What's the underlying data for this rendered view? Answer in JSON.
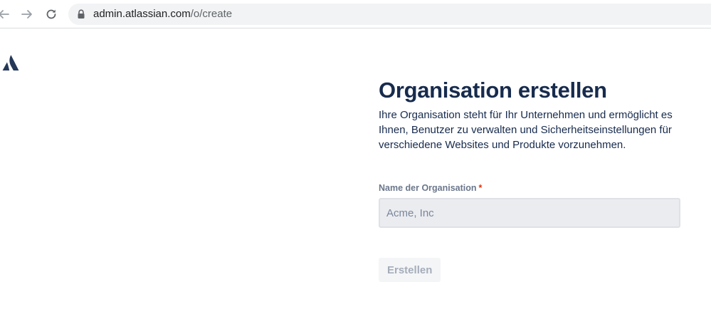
{
  "browser": {
    "url_host": "admin.atlassian.com",
    "url_path": "/o/create",
    "icons": [
      "back-arrow-icon",
      "forward-arrow-icon",
      "reload-icon",
      "lock-icon"
    ]
  },
  "logo": {
    "icon": "atlassian-logo-icon",
    "color": "#253858"
  },
  "form": {
    "title": "Organisation erstellen",
    "description": "Ihre Organisation steht für Ihr Unternehmen und ermöglicht es Ihnen, Benutzer zu verwalten und Sicherheitseinstellungen für verschiedene Websites und Produkte vorzunehmen.",
    "name_label": "Name der Organisation",
    "required_marker": "*",
    "name_placeholder": "Acme, Inc",
    "name_value": "",
    "submit_label": "Erstellen",
    "submit_disabled": true
  },
  "colors": {
    "heading": "#172b4d",
    "label": "#6b778c",
    "required": "#de350b",
    "input_bg": "#ebecf0",
    "button_disabled_bg": "#f4f5f7",
    "button_disabled_text": "#a5adba"
  }
}
